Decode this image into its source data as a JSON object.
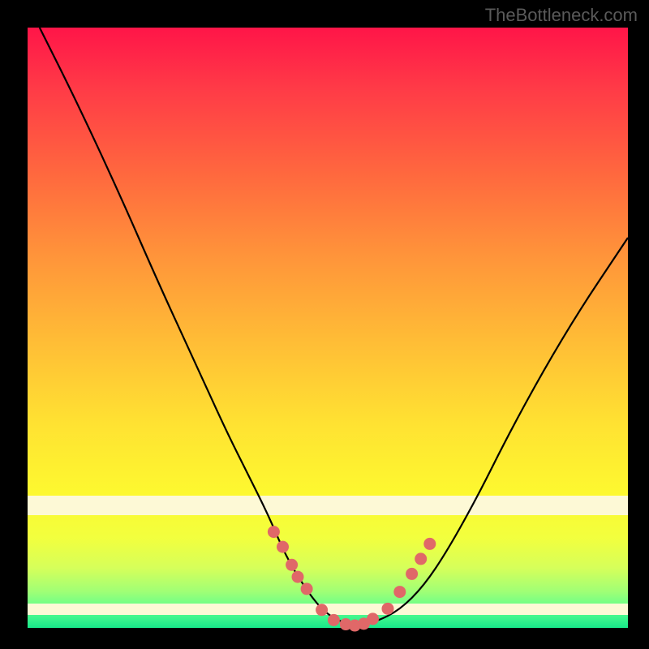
{
  "watermark": "TheBottleneck.com",
  "chart_data": {
    "type": "line",
    "title": "",
    "xlabel": "",
    "ylabel": "",
    "xlim": [
      0,
      100
    ],
    "ylim": [
      0,
      100
    ],
    "grid": false,
    "background_gradient": [
      "#ff1548",
      "#ff943a",
      "#ffe232",
      "#fdf92f",
      "#17e88a"
    ],
    "series": [
      {
        "name": "curve",
        "x": [
          2,
          8,
          15,
          22,
          28,
          33,
          37,
          40,
          43,
          46,
          49,
          52,
          55,
          58,
          62,
          66,
          70,
          75,
          80,
          86,
          92,
          98,
          100
        ],
        "y": [
          100,
          88,
          73,
          57,
          44,
          33,
          25,
          19,
          12,
          7,
          3,
          1,
          0.5,
          1,
          3,
          7,
          13,
          22,
          32,
          43,
          53,
          62,
          65
        ],
        "note": "V-shaped curve; minimum near x≈54"
      }
    ],
    "markers": {
      "name": "highlighted-points",
      "color": "#e06868",
      "x": [
        41,
        42.5,
        44,
        45,
        46.5,
        49,
        51,
        53,
        54.5,
        56,
        57.5,
        60,
        62,
        64,
        65.5,
        67
      ],
      "y": [
        16,
        13.5,
        10.5,
        8.5,
        6.5,
        3,
        1.3,
        0.6,
        0.4,
        0.7,
        1.5,
        3.2,
        6,
        9,
        11.5,
        14
      ]
    },
    "bands": [
      {
        "name": "cream-band-upper",
        "y": [
          19,
          22
        ]
      },
      {
        "name": "cream-band-lower",
        "y": [
          2,
          4
        ]
      }
    ]
  }
}
